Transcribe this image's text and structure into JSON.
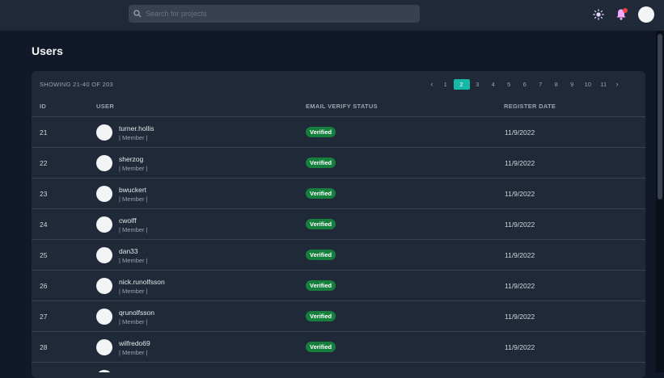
{
  "search": {
    "placeholder": "Search for projects"
  },
  "header": {
    "icons": [
      "theme-toggle-sun-icon",
      "notification-bell-icon",
      "user-avatar"
    ]
  },
  "page": {
    "title": "Users"
  },
  "table": {
    "showing": "SHOWING 21-40 OF 203",
    "pagination": {
      "prev": "‹",
      "next": "›",
      "pages": [
        "1",
        "2",
        "3",
        "4",
        "5",
        "6",
        "7",
        "8",
        "9",
        "10",
        "11"
      ],
      "current": "2"
    },
    "columns": {
      "id": "ID",
      "user": "USER",
      "email_status": "EMAIL VERIFY STATUS",
      "register_date": "REGISTER DATE"
    },
    "rows": [
      {
        "id": "21",
        "username": "turner.hollis",
        "role": "| Member |",
        "status": "Verified",
        "date": "11/9/2022"
      },
      {
        "id": "22",
        "username": "sherzog",
        "role": "| Member |",
        "status": "Verified",
        "date": "11/9/2022"
      },
      {
        "id": "23",
        "username": "bwuckert",
        "role": "| Member |",
        "status": "Verified",
        "date": "11/9/2022"
      },
      {
        "id": "24",
        "username": "cwolff",
        "role": "| Member |",
        "status": "Verified",
        "date": "11/9/2022"
      },
      {
        "id": "25",
        "username": "dan33",
        "role": "| Member |",
        "status": "Verified",
        "date": "11/9/2022"
      },
      {
        "id": "26",
        "username": "nick.runolfsson",
        "role": "| Member |",
        "status": "Verified",
        "date": "11/9/2022"
      },
      {
        "id": "27",
        "username": "qrunolfsson",
        "role": "| Member |",
        "status": "Verified",
        "date": "11/9/2022"
      },
      {
        "id": "28",
        "username": "wilfredo69",
        "role": "| Member |",
        "status": "Verified",
        "date": "11/9/2022"
      }
    ]
  },
  "colors": {
    "accent": "#14b8a6",
    "verified_badge": "#15803d",
    "notification_dot": "#ef4444",
    "background": "#111827",
    "surface": "#1f2937"
  }
}
